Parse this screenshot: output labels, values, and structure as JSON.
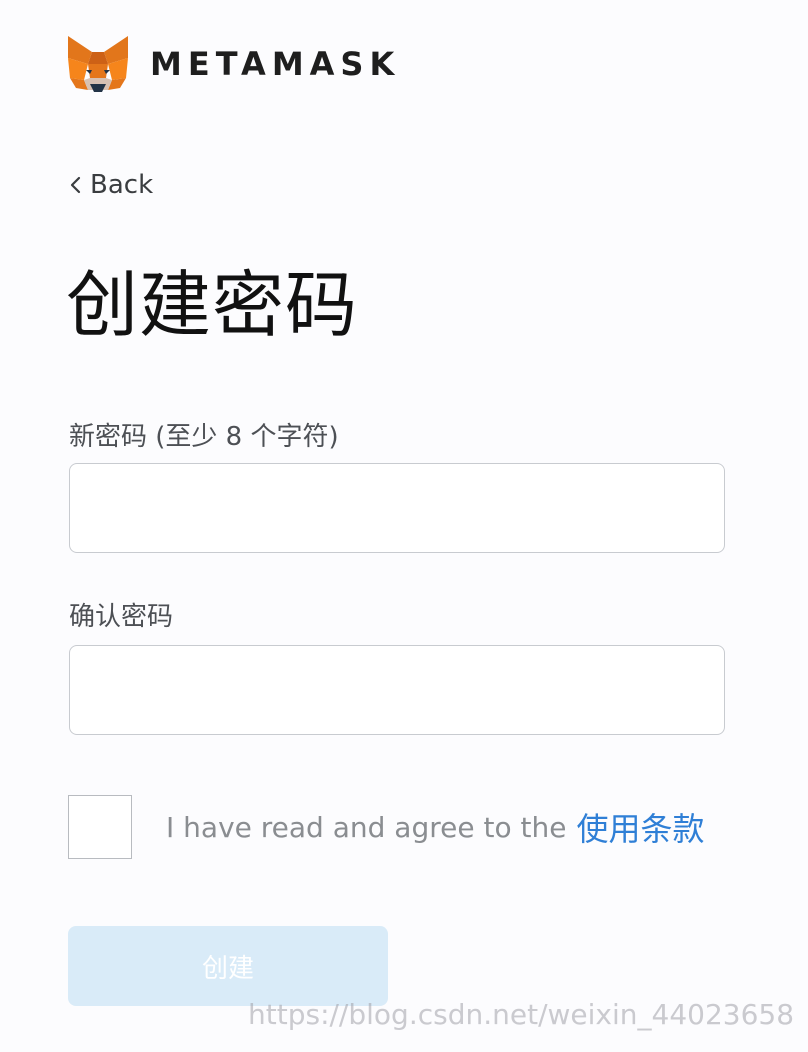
{
  "header": {
    "logo_icon": "metamask-fox-icon",
    "brand_name": "METAMASK"
  },
  "nav": {
    "back_icon": "chevron-left-icon",
    "back_label": "Back"
  },
  "page": {
    "title": "创建密码"
  },
  "form": {
    "new_password_label": "新密码 (至少 8 个字符)",
    "new_password_value": "",
    "confirm_password_label": "确认密码",
    "confirm_password_value": ""
  },
  "terms": {
    "checked": false,
    "text": "I have read and agree to the",
    "link_label": "使用条款"
  },
  "actions": {
    "create_label": "创建",
    "create_disabled": true
  },
  "watermark": {
    "text": "https://blog.csdn.net/weixin_44023658"
  },
  "colors": {
    "link": "#2f7fd6",
    "button_disabled_bg": "#d9ebf8",
    "fox_orange": "#f6851b"
  }
}
